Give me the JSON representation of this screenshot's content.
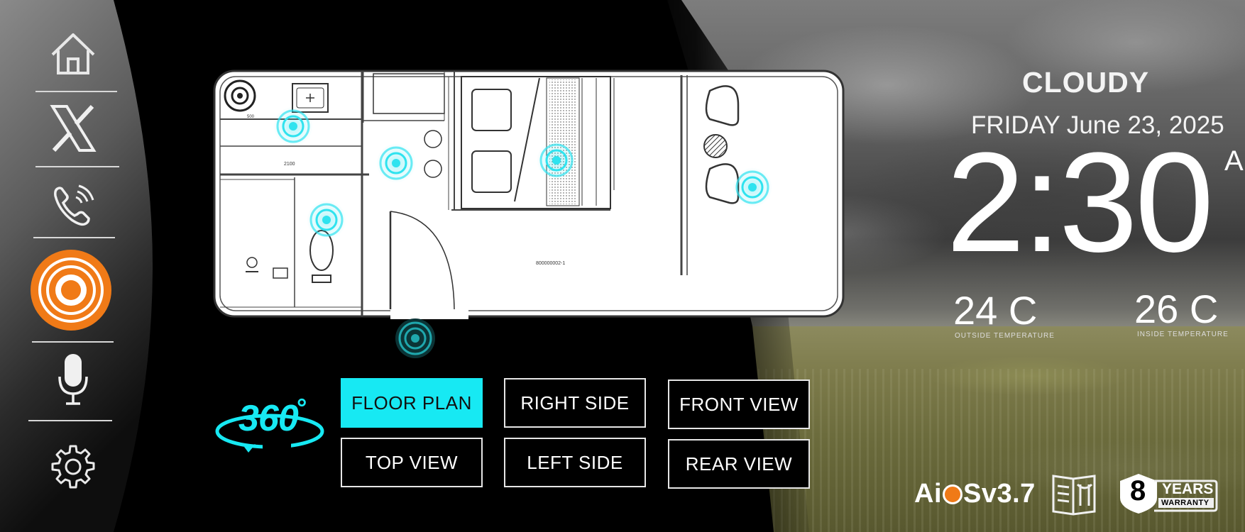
{
  "sidebar": {
    "items": [
      {
        "icon": "home-icon"
      },
      {
        "icon": "x-icon"
      },
      {
        "icon": "phone-icon"
      },
      {
        "icon": "sensor-target-icon",
        "active": true
      },
      {
        "icon": "microphone-icon"
      },
      {
        "icon": "gear-icon"
      }
    ],
    "active_color": "#f07a17"
  },
  "floorplan": {
    "label_1": "2100",
    "label_2": "500",
    "label_3": "800000002-1",
    "sensor_color": "#2fe3ef"
  },
  "views": {
    "badge": "360",
    "degree": "°",
    "buttons": [
      {
        "label": "FLOOR PLAN",
        "active": true
      },
      {
        "label": "RIGHT SIDE",
        "active": false
      },
      {
        "label": "FRONT VIEW",
        "active": false
      },
      {
        "label": "TOP VIEW",
        "active": false
      },
      {
        "label": "LEFT SIDE",
        "active": false
      },
      {
        "label": "REAR VIEW",
        "active": false
      }
    ],
    "active_color": "#17e9f3"
  },
  "weather": {
    "condition": "CLOUDY",
    "date": "FRIDAY June 23, 2025",
    "time": "2:30",
    "ampm": "AM",
    "temp_outside": "24 C",
    "temp_outside_label": "OUTSIDE TEMPERATURE",
    "temp_inside": "26 C",
    "temp_inside_label": "INSIDE TEMPERATURE"
  },
  "footer": {
    "os_version_prefix": "Ai",
    "os_version_suffix": "Sv3.7",
    "warranty_years": "8",
    "warranty_line1": "YEARS",
    "warranty_line2": "WARRANTY"
  }
}
